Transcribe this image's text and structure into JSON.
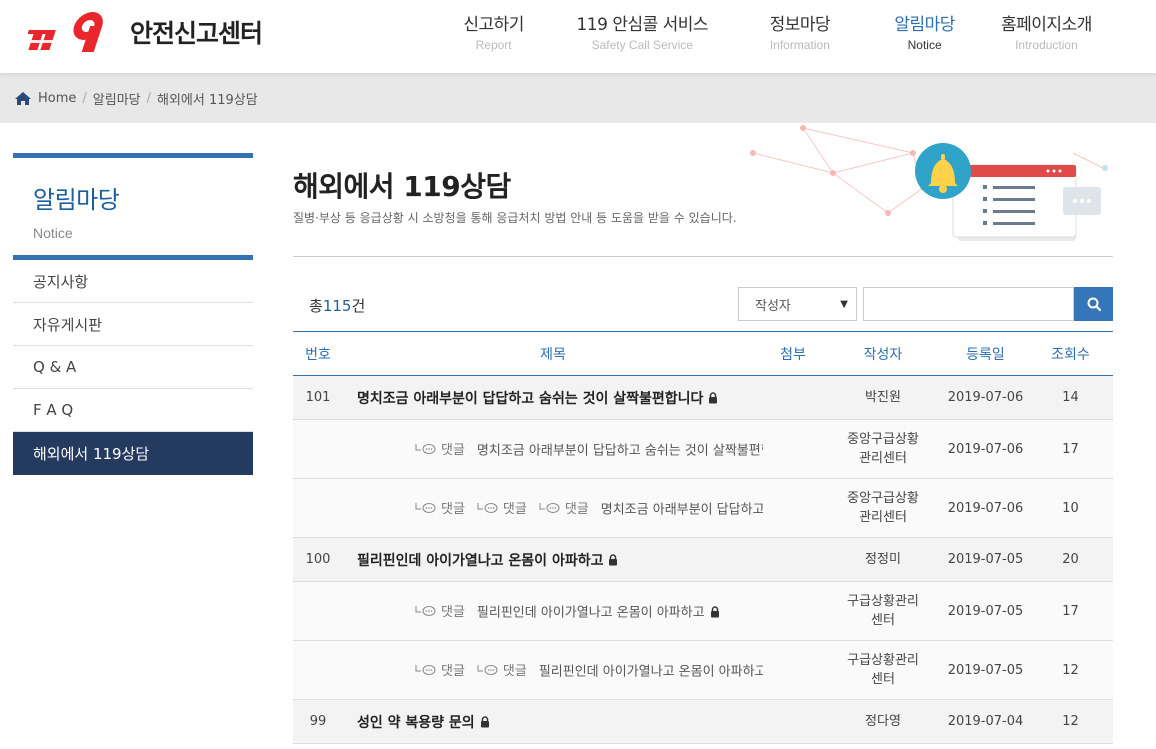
{
  "header": {
    "logo_text": "안전신고센터",
    "logo_mark": "119",
    "nav": [
      {
        "ko": "신고하기",
        "en": "Report",
        "active": false
      },
      {
        "ko": "119 안심콜 서비스",
        "en": "Safety Call Service",
        "active": false
      },
      {
        "ko": "정보마당",
        "en": "Information",
        "active": false
      },
      {
        "ko": "알림마당",
        "en": "Notice",
        "active": true
      },
      {
        "ko": "홈페이지소개",
        "en": "Introduction",
        "active": false
      }
    ]
  },
  "breadcrumb": [
    "Home",
    "알림마당",
    "해외에서 119상담"
  ],
  "sidebar": {
    "title": "알림마당",
    "subtitle": "Notice",
    "items": [
      {
        "label": "공지사항",
        "active": false
      },
      {
        "label": "자유게시판",
        "active": false
      },
      {
        "label": "Q & A",
        "active": false
      },
      {
        "label": "F A Q",
        "active": false
      },
      {
        "label": "해외에서 119상담",
        "active": true
      }
    ]
  },
  "page": {
    "title": "해외에서 119상담",
    "description": "질병·부상 등 응급상황 시 소방청을 통해 응급처치 방법 안내 등 도움을 받을 수 있습니다."
  },
  "list": {
    "total_prefix": "총",
    "total_count": "115",
    "total_suffix": "건",
    "search_field": "작성자",
    "search_value": "",
    "columns": [
      "번호",
      "제목",
      "첨부",
      "작성자",
      "등록일",
      "조회수"
    ],
    "rows": [
      {
        "num": "101",
        "subject": "명치조금 아래부분이 답답하고 숨쉬는 것이 살짝불편합니다",
        "reply_prefix": [],
        "writer": [
          "박진원"
        ],
        "date": "2019-07-06",
        "views": "14",
        "is_reply": false,
        "locked": true
      },
      {
        "num": "",
        "subject": "명치조금 아래부분이 답답하고 숨쉬는 것이 살짝불편합니다",
        "reply_prefix": [
          "댓글"
        ],
        "writer": [
          "중앙구급상황",
          "관리센터"
        ],
        "date": "2019-07-06",
        "views": "17",
        "is_reply": true,
        "locked": true
      },
      {
        "num": "",
        "subject": "명치조금 아래부분이 답답하고 숨…",
        "reply_prefix": [
          "댓글",
          "댓글",
          "댓글"
        ],
        "writer": [
          "중앙구급상황",
          "관리센터"
        ],
        "date": "2019-07-06",
        "views": "10",
        "is_reply": true,
        "locked": false
      },
      {
        "num": "100",
        "subject": "필리핀인데 아이가열나고 온몸이 아파하고",
        "reply_prefix": [],
        "writer": [
          "정정미"
        ],
        "date": "2019-07-05",
        "views": "20",
        "is_reply": false,
        "locked": true
      },
      {
        "num": "",
        "subject": "필리핀인데 아이가열나고 온몸이 아파하고",
        "reply_prefix": [
          "댓글"
        ],
        "writer": [
          "구급상황관리",
          "센터"
        ],
        "date": "2019-07-05",
        "views": "17",
        "is_reply": true,
        "locked": true
      },
      {
        "num": "",
        "subject": "필리핀인데 아이가열나고 온몸이 아파하고",
        "reply_prefix": [
          "댓글",
          "댓글"
        ],
        "writer": [
          "구급상황관리",
          "센터"
        ],
        "date": "2019-07-05",
        "views": "12",
        "is_reply": true,
        "locked": true
      },
      {
        "num": "99",
        "subject": "성인 약 복용량 문의",
        "reply_prefix": [],
        "writer": [
          "정다영"
        ],
        "date": "2019-07-04",
        "views": "12",
        "is_reply": false,
        "locked": true
      }
    ]
  },
  "colors": {
    "accent": "#2d6fb5",
    "sidebar_active": "#243a5e",
    "logo_red": "#e8262b",
    "search_btn": "#3576b9"
  },
  "icons": {
    "home": "home-icon",
    "search": "search-icon",
    "lock": "lock-icon",
    "reply": "reply-icon",
    "bell": "bell-icon"
  }
}
